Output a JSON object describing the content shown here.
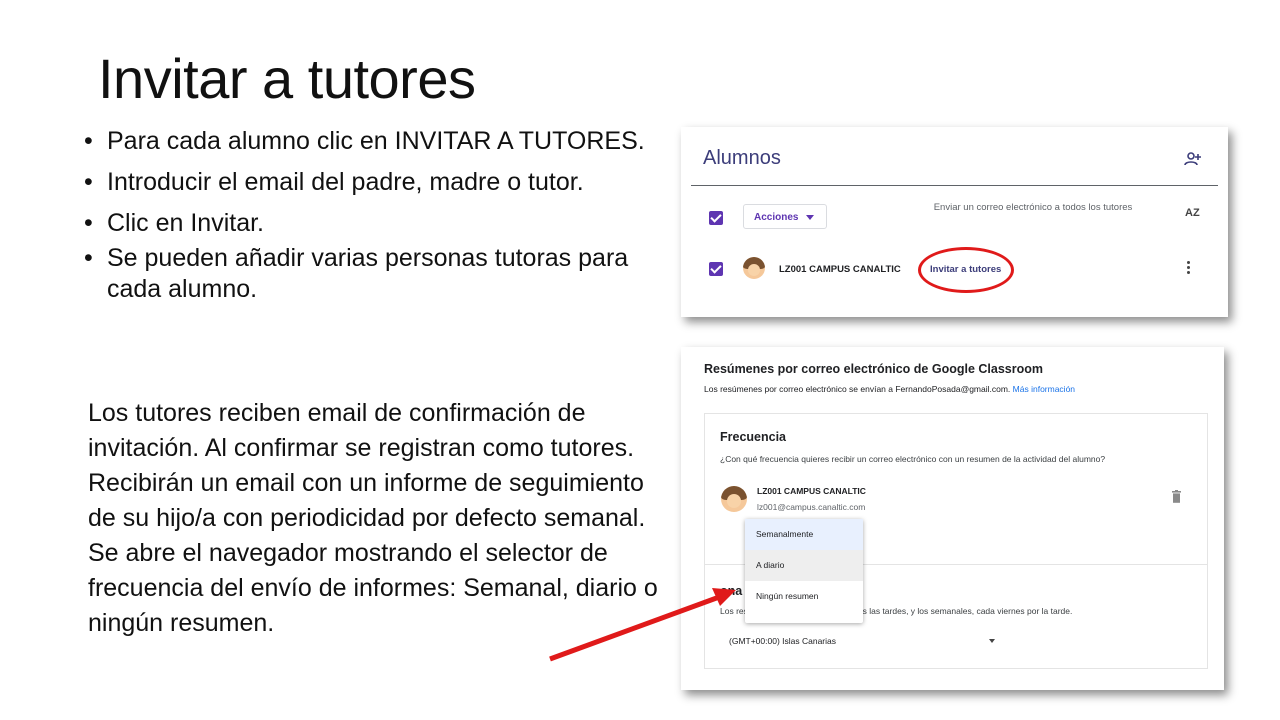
{
  "slide": {
    "title": "Invitar a tutores",
    "bullets": [
      "Para cada alumno clic en INVITAR A TUTORES.",
      "Introducir el email del padre, madre o tutor.",
      "Clic en Invitar.",
      "Se pueden añadir varias personas tutoras para cada alumno."
    ],
    "paragraph": [
      "Los tutores reciben email de confirmación de invitación. Al confirmar se registran como tutores. Recibirán un email con un informe de seguimiento de su hijo/a con periodicidad por defecto semanal.",
      "Se abre el navegador mostrando el selector de frecuencia del envío de informes: Semanal, diario o ningún resumen."
    ],
    "bullet_symbol": "•"
  },
  "alumnos_panel": {
    "title": "Alumnos",
    "add_icon": "person-add-icon",
    "actions_label": "Acciones",
    "send_email_text": "Enviar un correo electrónico a todos los tutores",
    "sort_icon": "sort-az-icon",
    "sort_label": "AZ",
    "student_name": "LZ001 CAMPUS CANALTIC",
    "invite_link": "Invitar a tutores",
    "more_icon": "more-vert-icon"
  },
  "resumenes_panel": {
    "title": "Resúmenes por correo electrónico de Google Classroom",
    "subtitle": "Los resúmenes por correo electrónico se envían a FernandoPosada@gmail.com.",
    "more_info_link": "Más información",
    "frequency_heading": "Frecuencia",
    "frequency_question": "¿Con qué frecuencia quieres recibir un correo electrónico con un resumen de la actividad del alumno?",
    "student_name": "LZ001 CAMPUS CANALTIC",
    "student_email": "lz001@campus.canaltic.com",
    "delete_icon": "trash-icon",
    "zone_heading_visible": "ona",
    "zone_text_left": "Los res",
    "zone_text_right": "as las tardes, y los semanales, cada viernes por la tarde.",
    "timezone_value": "(GMT+00:00) Islas Canarias",
    "menu_options": [
      "Semanalmente",
      "A diario",
      "Ningún resumen"
    ]
  },
  "colors": {
    "accent_purple": "#5e35b1",
    "annotation_red": "#e01a1a",
    "link_blue": "#1a73e8"
  }
}
